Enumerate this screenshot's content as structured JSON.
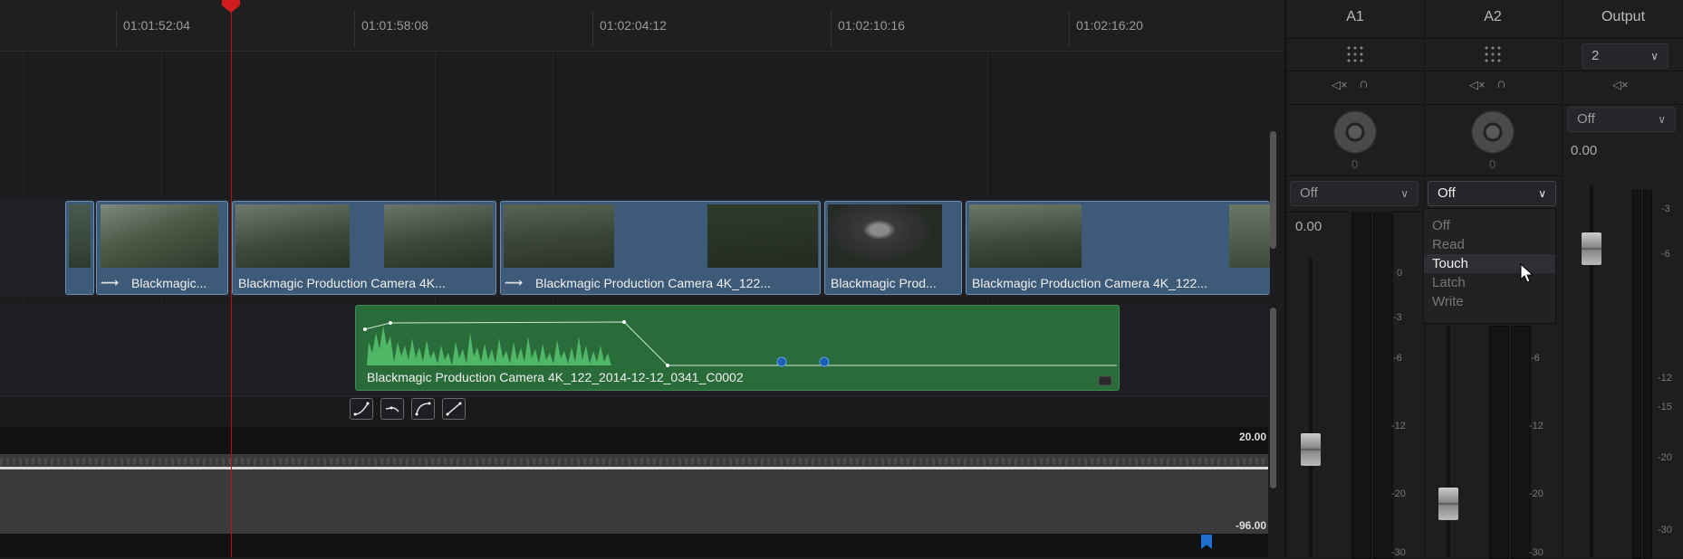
{
  "ruler": {
    "timecodes": [
      "01:01:52:04",
      "01:01:58:08",
      "01:02:04:12",
      "01:02:10:16",
      "01:02:16:20"
    ]
  },
  "video_clips": [
    {
      "label": ""
    },
    {
      "label": "Blackmagic..."
    },
    {
      "label": "Blackmagic Production Camera 4K..."
    },
    {
      "label": "Blackmagic Production Camera 4K_122..."
    },
    {
      "label": "Blackmagic Prod..."
    },
    {
      "label": "Blackmagic Production Camera 4K_122..."
    }
  ],
  "audio_clip": {
    "label": "Blackmagic Production Camera 4K_122_2014-12-12_0341_C0002"
  },
  "waveform": {
    "top_level": "20.00",
    "bottom_level": "-96.00"
  },
  "mixer": {
    "channels": [
      {
        "name": "A1",
        "pan_value": "0",
        "automation": "Off",
        "volume": "0.00",
        "fader_level": 0.36
      },
      {
        "name": "A2",
        "pan_value": "0",
        "automation": "Off",
        "volume": "",
        "fader_level": 0.23
      },
      {
        "name": "Output",
        "output_select": "2",
        "automation": "Off",
        "volume": "0.00",
        "fader_level": 0.83
      }
    ],
    "scale_labels": [
      "0",
      "-3",
      "-6",
      "-12",
      "-20",
      "-30"
    ],
    "scale_labels_output": [
      "-3",
      "-6",
      "-12",
      "-15",
      "-20",
      "-30"
    ],
    "automation_menu": {
      "items": [
        "Off",
        "Read",
        "Touch",
        "Latch",
        "Write"
      ],
      "highlighted": "Touch"
    }
  },
  "colors": {
    "video_clip": "#3d5a78",
    "audio_clip": "#2a6b3a",
    "playhead": "#b01818"
  }
}
